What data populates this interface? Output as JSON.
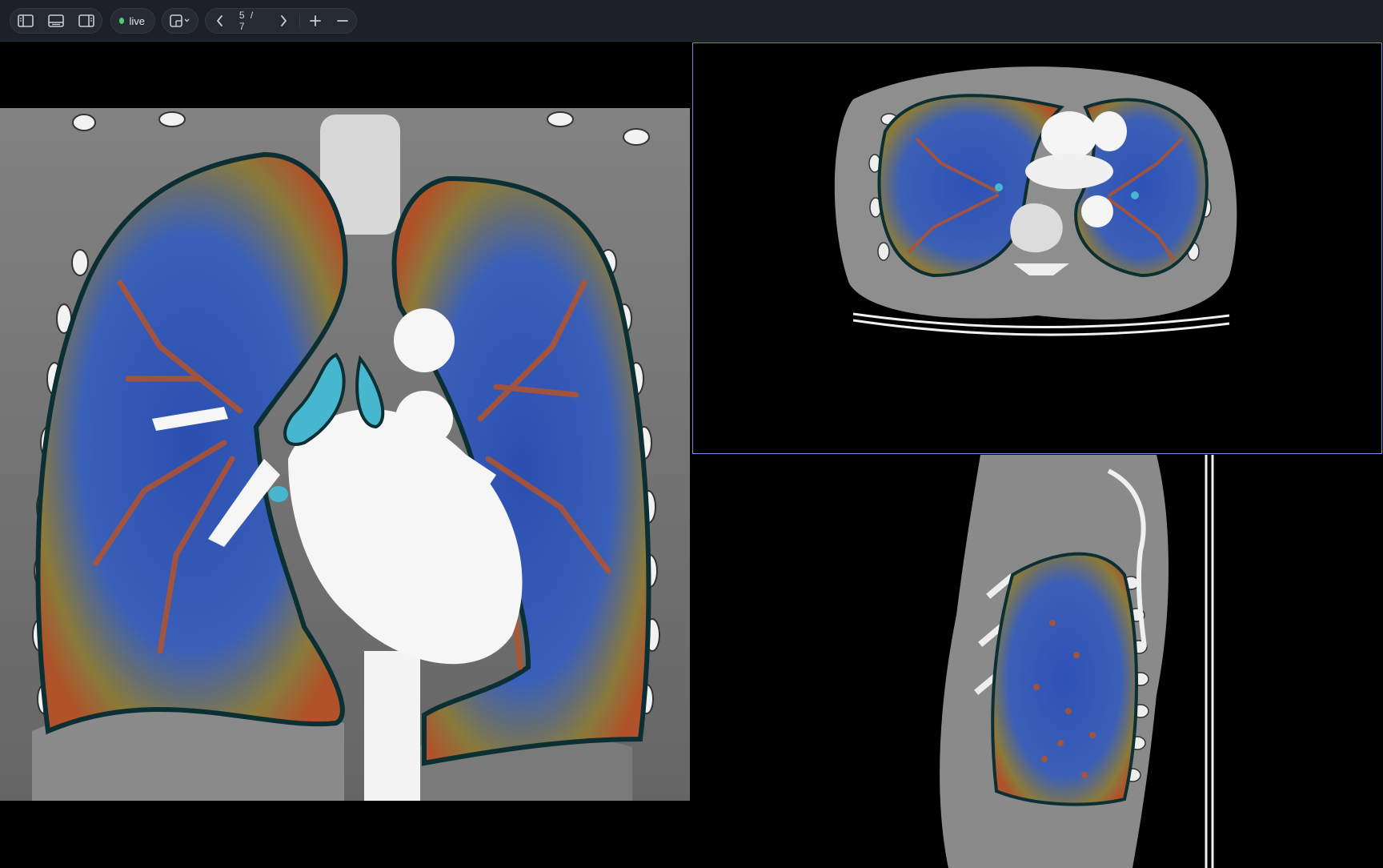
{
  "toolbar": {
    "layout_buttons": [
      {
        "icon": "sidebar-left-icon"
      },
      {
        "icon": "panel-bottom-icon"
      },
      {
        "icon": "sidebar-right-icon"
      }
    ],
    "live_label": "live",
    "live_color": "#4ccd6a",
    "layout_picker_icon": "layout-grid-icon",
    "prev_icon": "chevron-left-icon",
    "page_indicator": "5 / 7",
    "next_icon": "chevron-right-icon",
    "zoom_in_icon": "plus-icon",
    "zoom_out_icon": "minus-icon"
  },
  "viewports": {
    "active_border_color": "#6f8fd6",
    "views": [
      "coronal",
      "axial",
      "sagittal"
    ]
  }
}
